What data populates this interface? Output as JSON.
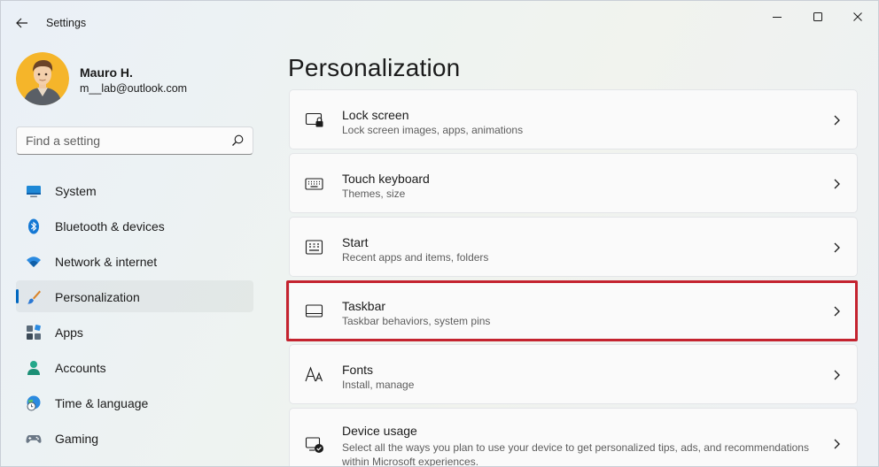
{
  "window": {
    "title": "Settings"
  },
  "profile": {
    "name": "Mauro H.",
    "email": "m__lab@outlook.com"
  },
  "search": {
    "placeholder": "Find a setting"
  },
  "nav": {
    "items": [
      {
        "label": "System",
        "icon": "monitor-icon"
      },
      {
        "label": "Bluetooth & devices",
        "icon": "bluetooth-icon"
      },
      {
        "label": "Network & internet",
        "icon": "wifi-icon"
      },
      {
        "label": "Personalization",
        "icon": "brush-icon",
        "active": true
      },
      {
        "label": "Apps",
        "icon": "apps-icon"
      },
      {
        "label": "Accounts",
        "icon": "person-icon"
      },
      {
        "label": "Time & language",
        "icon": "globe-clock-icon"
      },
      {
        "label": "Gaming",
        "icon": "gamepad-icon"
      }
    ]
  },
  "main": {
    "title": "Personalization",
    "cards": [
      {
        "title": "Lock screen",
        "subtitle": "Lock screen images, apps, animations",
        "icon": "lock-screen-icon"
      },
      {
        "title": "Touch keyboard",
        "subtitle": "Themes, size",
        "icon": "keyboard-icon"
      },
      {
        "title": "Start",
        "subtitle": "Recent apps and items, folders",
        "icon": "start-icon"
      },
      {
        "title": "Taskbar",
        "subtitle": "Taskbar behaviors, system pins",
        "icon": "taskbar-icon",
        "highlighted": true
      },
      {
        "title": "Fonts",
        "subtitle": "Install, manage",
        "icon": "fonts-icon"
      },
      {
        "title": "Device usage",
        "subtitle": "Select all the ways you plan to use your device to get personalized tips, ads, and recommendations within Microsoft experiences.",
        "icon": "device-usage-icon"
      }
    ]
  },
  "colors": {
    "accent": "#0067c0",
    "highlight": "#c4232f"
  }
}
